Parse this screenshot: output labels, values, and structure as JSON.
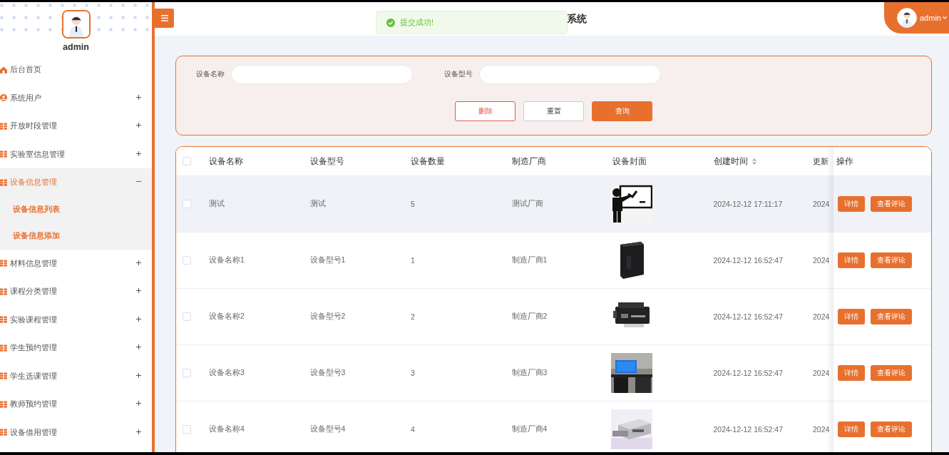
{
  "sidebar": {
    "user_name": "admin",
    "menu": [
      {
        "label": "后台首页"
      },
      {
        "label": "系统用户",
        "expanded": false
      },
      {
        "label": "开放时段管理",
        "expanded": false
      },
      {
        "label": "实验室信息管理",
        "expanded": false
      },
      {
        "label": "设备信息管理",
        "expanded": true,
        "children": [
          {
            "label": "设备信息列表"
          },
          {
            "label": "设备信息添加"
          }
        ]
      },
      {
        "label": "材料信息管理",
        "expanded": false
      },
      {
        "label": "课程分类管理",
        "expanded": false
      },
      {
        "label": "实验课程管理",
        "expanded": false
      },
      {
        "label": "学生预约管理",
        "expanded": false
      },
      {
        "label": "学生选课管理",
        "expanded": false
      },
      {
        "label": "教师预约管理",
        "expanded": false
      },
      {
        "label": "设备借用管理",
        "expanded": false
      }
    ]
  },
  "header": {
    "title": "系统",
    "user_name": "admin"
  },
  "toast": {
    "kind": "success",
    "message": "提交成功!"
  },
  "search": {
    "fields": [
      {
        "label": "设备名称"
      },
      {
        "label": "设备型号"
      }
    ],
    "buttons": [
      {
        "label": "删除",
        "kind": "danger"
      },
      {
        "label": "重置",
        "kind": "plain"
      },
      {
        "label": "查询",
        "kind": "primary"
      }
    ]
  },
  "table": {
    "select_all_checked": false,
    "columns": [
      {
        "label": "设备名称"
      },
      {
        "label": "设备型号"
      },
      {
        "label": "设备数量"
      },
      {
        "label": "制造厂商"
      },
      {
        "label": "设备封面"
      },
      {
        "label": "创建时间",
        "sortable": true
      },
      {
        "label": "更新"
      }
    ],
    "action_column": "操作",
    "rows": [
      {
        "checked": false,
        "hovered": true,
        "cells": [
          "测试",
          "测试",
          "5",
          "测试厂商"
        ],
        "cover": {
          "kind": "picture"
        },
        "created_at": "2024-12-12 17:11:17",
        "updated_at": "2024",
        "actions": [
          "详情",
          "查看评论"
        ]
      },
      {
        "checked": false,
        "hovered": false,
        "cells": [
          "设备名称1",
          "设备型号1",
          "1",
          "制造厂商1"
        ],
        "cover": {
          "kind": "picture"
        },
        "created_at": "2024-12-12 16:52:47",
        "updated_at": "2024",
        "actions": [
          "详情",
          "查看评论"
        ]
      },
      {
        "checked": false,
        "hovered": false,
        "cells": [
          "设备名称2",
          "设备型号2",
          "2",
          "制造厂商2"
        ],
        "cover": {
          "kind": "picture"
        },
        "created_at": "2024-12-12 16:52:47",
        "updated_at": "2024",
        "actions": [
          "详情",
          "查看评论"
        ]
      },
      {
        "checked": false,
        "hovered": false,
        "cells": [
          "设备名称3",
          "设备型号3",
          "3",
          "制造厂商3"
        ],
        "cover": {
          "kind": "picture"
        },
        "created_at": "2024-12-12 16:52:47",
        "updated_at": "2024",
        "actions": [
          "详情",
          "查看评论"
        ]
      },
      {
        "checked": false,
        "hovered": false,
        "cells": [
          "设备名称4",
          "设备型号4",
          "4",
          "制造厂商4"
        ],
        "cover": {
          "kind": "picture"
        },
        "created_at": "2024-12-12 16:52:47",
        "updated_at": "2024",
        "actions": [
          "详情",
          "查看评论"
        ]
      }
    ]
  }
}
